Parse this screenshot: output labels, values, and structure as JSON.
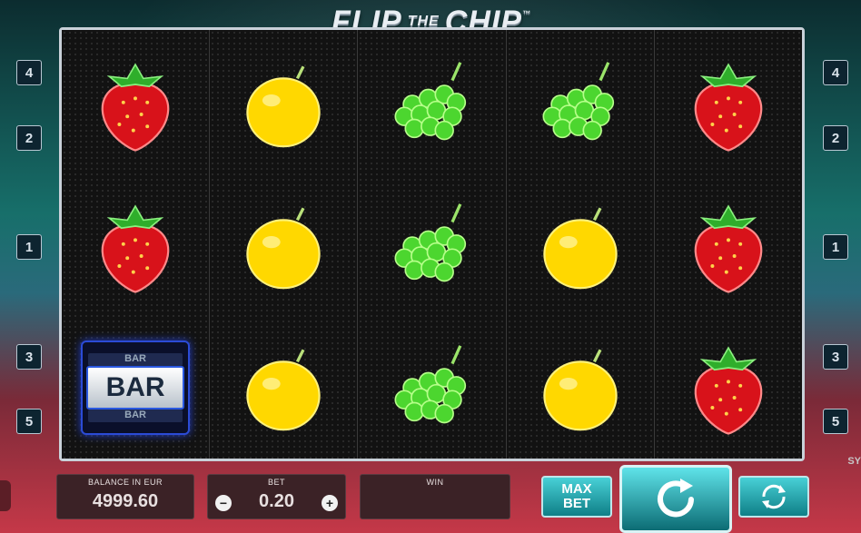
{
  "logo": {
    "part1": "FLIP",
    "part2": "THE",
    "part3": "CHIP",
    "tm": "™"
  },
  "paylines_left": [
    "4",
    "2",
    "1",
    "3",
    "5"
  ],
  "paylines_right": [
    "4",
    "2",
    "1",
    "3",
    "5"
  ],
  "reels": [
    [
      "strawberry",
      "strawberry",
      "bar"
    ],
    [
      "lemon",
      "lemon",
      "lemon"
    ],
    [
      "grapes",
      "grapes",
      "grapes"
    ],
    [
      "grapes",
      "lemon",
      "lemon"
    ],
    [
      "strawberry",
      "strawberry",
      "strawberry"
    ]
  ],
  "bar_text": "BAR",
  "bar_edge_text": "BAR",
  "balance": {
    "label": "BALANCE IN EUR",
    "value": "4999.60"
  },
  "bet": {
    "label": "BET",
    "value": "0.20",
    "minus": "−",
    "plus": "+"
  },
  "win": {
    "label": "WIN",
    "value": ""
  },
  "maxbet": {
    "line1": "MAX",
    "line2": "BET"
  },
  "brand_fragment": "SY"
}
